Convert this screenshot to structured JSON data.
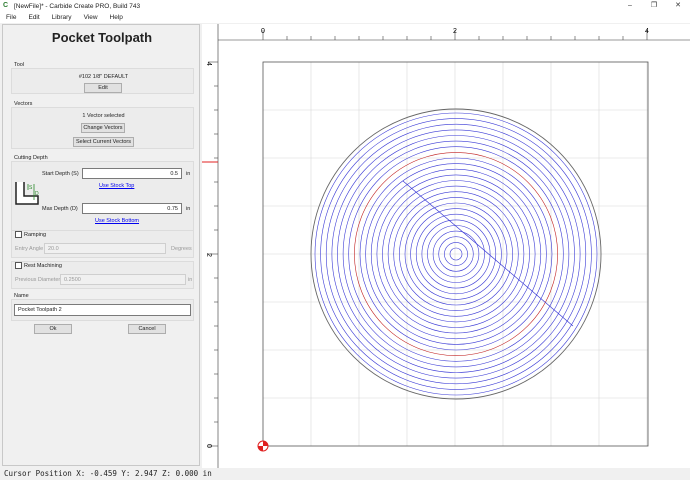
{
  "window": {
    "title": "[NewFile]* - Carbide Create PRO, Build 743",
    "icon": "carbide-logo-icon",
    "minimize": "–",
    "maximize": "❐",
    "close": "✕"
  },
  "menu": [
    "File",
    "Edit",
    "Library",
    "View",
    "Help"
  ],
  "panel": {
    "title": "Pocket Toolpath",
    "tool": {
      "label": "Tool",
      "name": "#102 1/8\" DEFAULT",
      "edit": "Edit"
    },
    "vectors": {
      "label": "Vectors",
      "selected": "1 Vector selected",
      "change": "Change Vectors",
      "select_current": "Select Current Vectors"
    },
    "cutting_depth": {
      "label": "Cutting Depth",
      "start_label": "Start Depth (S)",
      "start_value": "0.5",
      "start_unit": "in",
      "use_stock_top": "Use Stock Top",
      "max_label": "Max Depth (D)",
      "max_value": "0.75",
      "max_unit": "in",
      "use_stock_bottom": "Use Stock Bottom",
      "diagram_s": "S",
      "diagram_d": "D"
    },
    "ramping": {
      "label": "Ramping",
      "checked": false,
      "entry_label": "Entry Angle",
      "entry_value": "20.0",
      "entry_unit": "Degrees"
    },
    "rest": {
      "label": "Rest Machining",
      "checked": false,
      "prev_label": "Previous Diameter",
      "prev_value": "0.2500",
      "prev_unit": "in"
    },
    "name": {
      "label": "Name",
      "value": "Pocket Toolpath 2"
    },
    "ok": "Ok",
    "cancel": "Cancel"
  },
  "rulers": {
    "top": [
      "0",
      "2",
      "4"
    ],
    "left": [
      "4",
      "2",
      "0"
    ]
  },
  "canvas": {
    "background": "#ffffff",
    "stock_border": "#555555",
    "grid_color": "#d8d8d8",
    "pocket_color": "#3b3bd6",
    "outline_color": "#666666",
    "highlight_ring_color": "#c02020",
    "origin_color": "#e02020",
    "rings": 25
  },
  "status": {
    "text": "Cursor Position X: -0.459 Y: 2.947 Z: 0.000 in"
  }
}
